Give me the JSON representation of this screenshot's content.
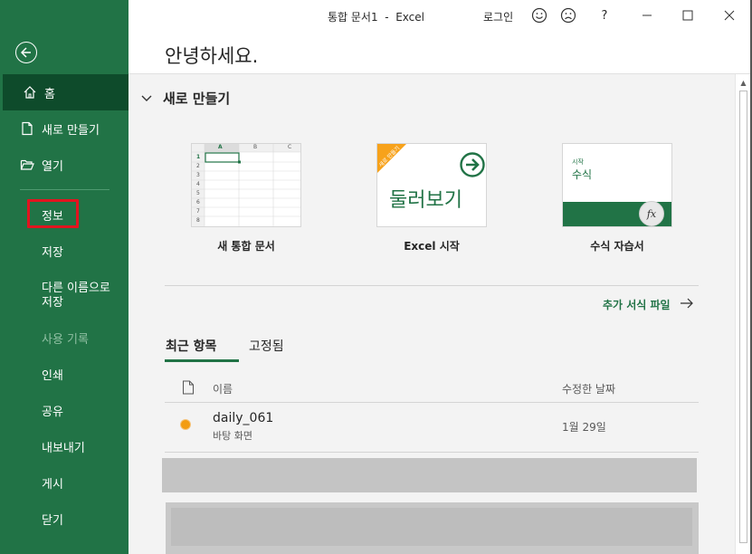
{
  "window": {
    "title": "통합 문서1  -  Excel",
    "login": "로그인",
    "help": "?"
  },
  "sidebar": {
    "items": [
      {
        "label": "홈",
        "icon": "home-icon"
      },
      {
        "label": "새로 만들기",
        "icon": "new-document-icon"
      },
      {
        "label": "열기",
        "icon": "folder-open-icon"
      },
      {
        "label": "정보"
      },
      {
        "label": "저장"
      },
      {
        "label": "다른 이름으로\n저장"
      },
      {
        "label": "사용 기록"
      },
      {
        "label": "인쇄"
      },
      {
        "label": "공유"
      },
      {
        "label": "내보내기"
      },
      {
        "label": "게시"
      },
      {
        "label": "닫기"
      }
    ]
  },
  "greeting": "안녕하세요.",
  "new_section": {
    "title": "새로 만들기",
    "templates": [
      {
        "label": "새 통합 문서",
        "grid_cols": [
          "A",
          "B",
          "C"
        ],
        "grid_rows": [
          "1",
          "2",
          "3",
          "4",
          "5",
          "6",
          "7",
          "8"
        ]
      },
      {
        "label": "Excel 시작",
        "banner": "새로 만들기",
        "tile_text": "둘러보기"
      },
      {
        "label": "수식 자습서",
        "small": "시작",
        "big": "수식",
        "fx": "fx"
      }
    ],
    "more": "추가 서식 파일"
  },
  "tabs": {
    "recent": "최근 항목",
    "pinned": "고정됨"
  },
  "list": {
    "col_name": "이름",
    "col_date": "수정한 날짜",
    "rows": [
      {
        "name": "daily_061",
        "location": "바탕 화면",
        "date": "1월 29일"
      }
    ]
  },
  "colors": {
    "accent": "#217346",
    "selected": "#0e4b2b",
    "highlight": "#e2141f"
  }
}
